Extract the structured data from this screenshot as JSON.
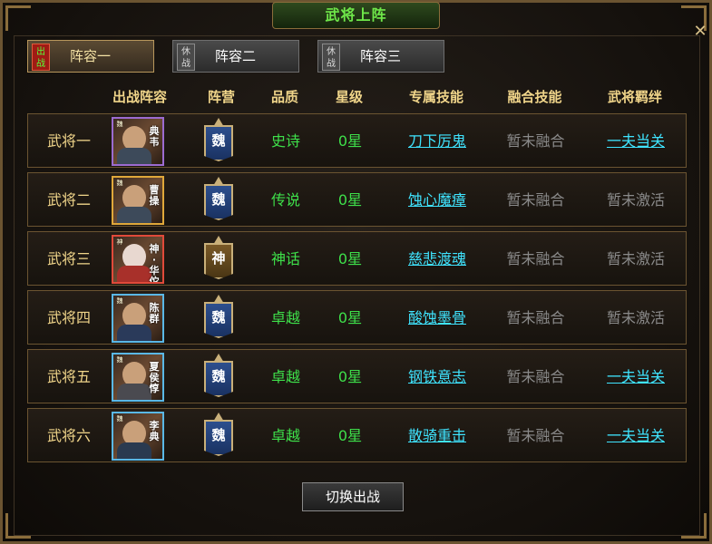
{
  "title": "武将上阵",
  "tabs": [
    {
      "badge": "出战",
      "label": "阵容一",
      "active": true
    },
    {
      "badge": "休战",
      "label": "阵容二",
      "active": false
    },
    {
      "badge": "休战",
      "label": "阵容三",
      "active": false
    }
  ],
  "headers": {
    "lineup": "出战阵容",
    "camp": "阵营",
    "quality": "品质",
    "star": "星级",
    "skill": "专属技能",
    "fusion": "融合技能",
    "bond": "武将羁绊"
  },
  "rows": [
    {
      "name": "武将一",
      "tag": "魏",
      "portrait": "典韦",
      "frame": "purple",
      "camp": "魏",
      "camp_type": "wei",
      "quality": "史诗",
      "star": "0星",
      "skill": "刀下厉鬼",
      "fusion": "暂未融合",
      "bond": "一夫当关",
      "bond_active": true
    },
    {
      "name": "武将二",
      "tag": "魏",
      "portrait": "曹操",
      "frame": "gold",
      "camp": "魏",
      "camp_type": "wei",
      "quality": "传说",
      "star": "0星",
      "skill": "蚀心魔瘴",
      "fusion": "暂未融合",
      "bond": "暂未激活",
      "bond_active": false
    },
    {
      "name": "武将三",
      "tag": "神",
      "portrait": "神·华佗",
      "frame": "red",
      "camp": "神",
      "camp_type": "shen",
      "quality": "神话",
      "star": "0星",
      "skill": "慈悲渡魂",
      "fusion": "暂未融合",
      "bond": "暂未激活",
      "bond_active": false
    },
    {
      "name": "武将四",
      "tag": "魏",
      "portrait": "陈群",
      "frame": "blue",
      "camp": "魏",
      "camp_type": "wei",
      "quality": "卓越",
      "star": "0星",
      "skill": "酸蚀墨骨",
      "fusion": "暂未融合",
      "bond": "暂未激活",
      "bond_active": false
    },
    {
      "name": "武将五",
      "tag": "魏",
      "portrait": "夏侯惇",
      "frame": "blue",
      "camp": "魏",
      "camp_type": "wei",
      "quality": "卓越",
      "star": "0星",
      "skill": "钢铁意志",
      "fusion": "暂未融合",
      "bond": "一夫当关",
      "bond_active": true
    },
    {
      "name": "武将六",
      "tag": "魏",
      "portrait": "李典",
      "frame": "blue",
      "camp": "魏",
      "camp_type": "wei",
      "quality": "卓越",
      "star": "0星",
      "skill": "散骑重击",
      "fusion": "暂未融合",
      "bond": "一夫当关",
      "bond_active": true
    }
  ],
  "switch_button": "切换出战",
  "colors": {
    "gold_text": "#f0d58a",
    "green_text": "#3ee04a",
    "cyan_link": "#3fe4ff",
    "gray_text": "#8a8a8a",
    "border": "#6b5431"
  }
}
